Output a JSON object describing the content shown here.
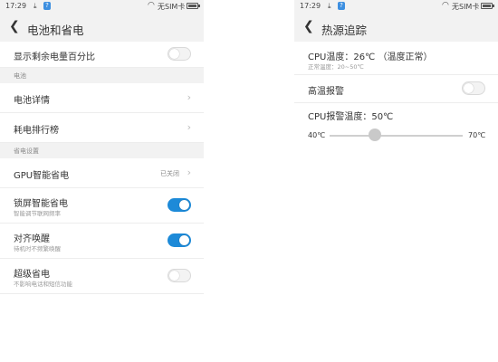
{
  "status_bar": {
    "time": "17:29",
    "usb_icon": "download-arrow-icon",
    "badge": "?",
    "sim_text": "无SIM卡"
  },
  "left": {
    "title": "电池和省电",
    "show_percent": {
      "label": "显示剩余电量百分比",
      "toggle_on": false
    },
    "section_battery": "电池",
    "battery_details": "电池详情",
    "power_ranking": "耗电排行榜",
    "section_saving": "省电设置",
    "gpu": {
      "label": "GPU智能省电",
      "status": "已关闭"
    },
    "lock_saving": {
      "label": "锁屏智能省电",
      "sub": "智能调节联网频率",
      "toggle_on": true
    },
    "align_wakeup": {
      "label": "对齐唤醒",
      "sub": "待机时不频繁唤醒",
      "toggle_on": true
    },
    "super_saving": {
      "label": "超级省电",
      "sub": "不影响电话和短信功能",
      "toggle_on": false
    }
  },
  "right": {
    "title": "热源追踪",
    "cpu_temp": {
      "label": "CPU温度：26℃ （温度正常）",
      "sub": "正常温度：20~50℃"
    },
    "high_temp_alarm": {
      "label": "高温报警",
      "toggle_on": false
    },
    "alarm_temp": {
      "label": "CPU报警温度：50℃",
      "min": "40℃",
      "max": "70℃",
      "value": 50
    }
  },
  "colors": {
    "accent": "#1d8ad8",
    "header_bg": "#f2f2f2"
  }
}
